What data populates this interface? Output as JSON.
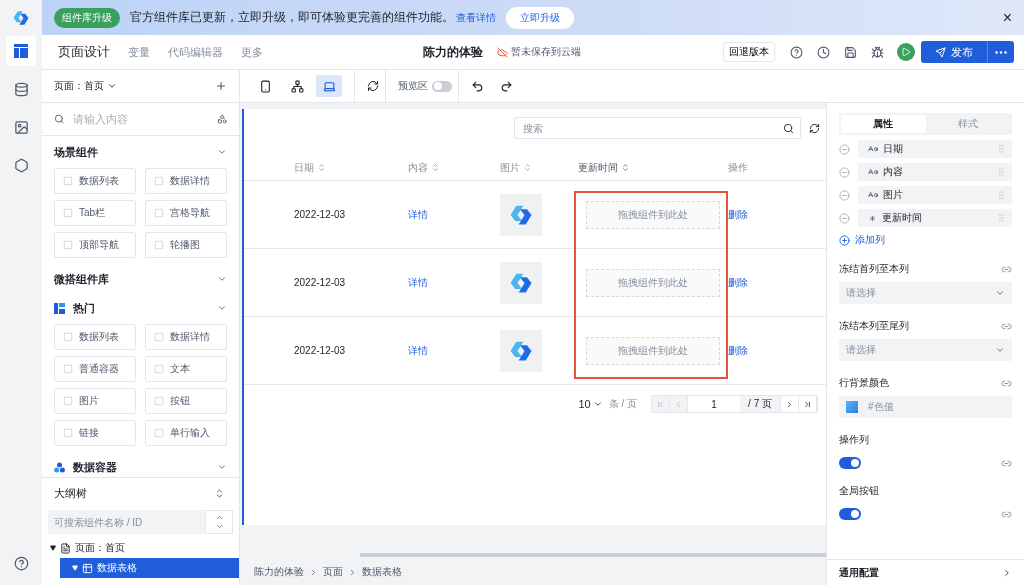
{
  "banner": {
    "tag": "组件库升级",
    "message": "官方组件库已更新，立即升级，即可体验更完善的组件功能。",
    "link": "查看详情",
    "button": "立即升级",
    "close": "×"
  },
  "rail": [
    {
      "kind": "layout",
      "selected": true
    },
    {
      "kind": "database",
      "selected": false
    },
    {
      "kind": "image",
      "selected": false
    },
    {
      "kind": "hexagon",
      "selected": false
    }
  ],
  "header": {
    "tabs": [
      {
        "label": "页面设计",
        "selected": true
      },
      {
        "label": "变量",
        "selected": false
      },
      {
        "label": "代码编辑器",
        "selected": false
      },
      {
        "label": "更多",
        "selected": false
      }
    ],
    "project": "陈力的体验",
    "save_status": "暂未保存到云端",
    "revert_button": "回退版本",
    "publish_button": "发布"
  },
  "toolbar": {
    "devices": [
      {
        "kind": "phone",
        "selected": false
      },
      {
        "kind": "miniprogram",
        "selected": false
      },
      {
        "kind": "desktop",
        "selected": true
      }
    ],
    "preview_label": "预览区",
    "preview_on": false
  },
  "left_panel": {
    "page_selector": "页面：首页",
    "search_placeholder": "请输入内容",
    "sections": [
      {
        "kind": "heading",
        "title": "场景组件",
        "items": [
          {
            "label": "数据列表"
          },
          {
            "label": "数据详情"
          },
          {
            "label": "Tab栏"
          },
          {
            "label": "宫格导航"
          },
          {
            "label": "顶部导航"
          },
          {
            "label": "轮播图"
          }
        ]
      },
      {
        "kind": "heading",
        "title": "微搭组件库"
      },
      {
        "kind": "category",
        "title": "热门",
        "items": [
          {
            "label": "数据列表"
          },
          {
            "label": "数据详情"
          },
          {
            "label": "普通容器"
          },
          {
            "label": "文本"
          },
          {
            "label": "图片"
          },
          {
            "label": "按钮"
          },
          {
            "label": "链接"
          },
          {
            "label": "单行输入"
          }
        ]
      },
      {
        "kind": "category",
        "title": "数据容器"
      }
    ],
    "outline": {
      "title": "大纲树",
      "search_placeholder": "可搜索组件名称 / ID",
      "tree": [
        {
          "label": "页面：首页",
          "expanded": true,
          "selected": false,
          "children": [
            {
              "label": "数据表格",
              "expanded": true,
              "selected": true
            }
          ]
        }
      ]
    }
  },
  "table": {
    "search_placeholder": "搜索",
    "columns": [
      {
        "label": "日期",
        "sortable": true,
        "highlighted": false
      },
      {
        "label": "内容",
        "sortable": true,
        "highlighted": false
      },
      {
        "label": "图片",
        "sortable": true,
        "highlighted": false
      },
      {
        "label": "更新时间",
        "sortable": true,
        "highlighted": true
      },
      {
        "label": "操作",
        "sortable": false,
        "highlighted": false
      }
    ],
    "rows": [
      {
        "date": "2022-12-03",
        "content": "详情",
        "drop_hint": "拖拽组件到此处",
        "action": "删除"
      },
      {
        "date": "2022-12-03",
        "content": "详情",
        "drop_hint": "拖拽组件到此处",
        "action": "删除"
      },
      {
        "date": "2022-12-03",
        "content": "详情",
        "drop_hint": "拖拽组件到此处",
        "action": "删除"
      }
    ],
    "pagination": {
      "page_size": "10",
      "unit": "条 / 页",
      "page": "1",
      "total": "/ 7 页"
    }
  },
  "breadcrumb": [
    "陈力的体验",
    "页面",
    "数据表格"
  ],
  "right_panel": {
    "tabs": [
      {
        "label": "属性",
        "selected": true
      },
      {
        "label": "样式",
        "selected": false
      }
    ],
    "columns": [
      {
        "label": "日期",
        "kind": "text"
      },
      {
        "label": "内容",
        "kind": "text"
      },
      {
        "label": "图片",
        "kind": "text"
      },
      {
        "label": "更新时间",
        "kind": "custom"
      }
    ],
    "add_column": "添加列",
    "fields": [
      {
        "kind": "select",
        "label": "冻结首列至本列",
        "placeholder": "请选择"
      },
      {
        "kind": "select",
        "label": "冻结本列至尾列",
        "placeholder": "请选择"
      },
      {
        "kind": "color",
        "label": "行背景颜色",
        "placeholder": "#色值"
      },
      {
        "kind": "switch",
        "label": "操作列",
        "on": true
      },
      {
        "kind": "switch",
        "label": "全局按钮",
        "on": true
      }
    ],
    "footer": "通用配置"
  }
}
